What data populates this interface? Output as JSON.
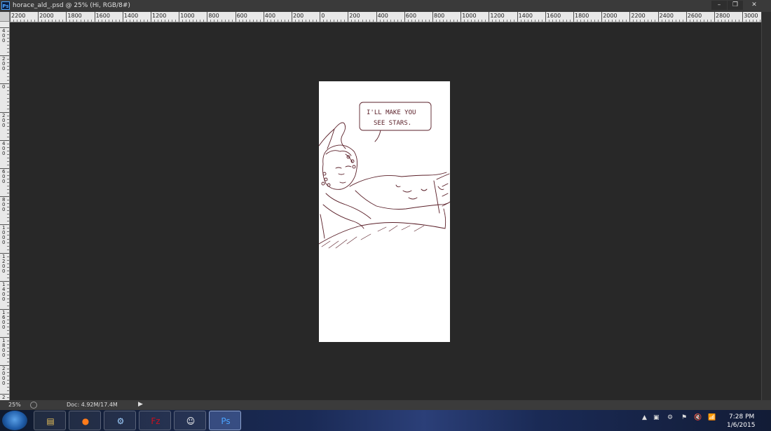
{
  "window": {
    "app_badge": "Ps",
    "title": "horace_ald_.psd @ 25% (Hi, RGB/8#)",
    "controls": {
      "minimize": "–",
      "restore": "❐",
      "close": "✕"
    }
  },
  "ruler_h": {
    "labels": [
      "2200",
      "2000",
      "1800",
      "1600",
      "1400",
      "1200",
      "1000",
      "800",
      "600",
      "400",
      "200",
      "0",
      "200",
      "400",
      "600",
      "800",
      "1000",
      "1200",
      "1400",
      "1600",
      "1800",
      "2000",
      "2200",
      "2400",
      "2600",
      "2800",
      "3000"
    ]
  },
  "ruler_v": {
    "labels": [
      "400",
      "200",
      "0",
      "200",
      "400",
      "600",
      "800",
      "1000",
      "1200",
      "1400",
      "1600",
      "1800",
      "2000",
      "2200"
    ]
  },
  "document": {
    "speech": [
      "I'LL MAKE YOU",
      "SEE STARS."
    ],
    "background_color": "#ffffff",
    "line_color": "#5a1f28"
  },
  "status": {
    "zoom": "25%",
    "doc_info": "Doc: 4.92M/17.4M",
    "arrow": "▶"
  },
  "taskbar": {
    "start": "start-orb",
    "apps": [
      {
        "name": "file-explorer",
        "glyph": "▤",
        "color": "#e8c15a"
      },
      {
        "name": "firefox",
        "glyph": "●",
        "color": "#ff7b1a"
      },
      {
        "name": "network-tool",
        "glyph": "⚙",
        "color": "#9fd0ff"
      },
      {
        "name": "filezilla",
        "glyph": "Fz",
        "color": "#c8101e"
      },
      {
        "name": "pidgin",
        "glyph": "☺",
        "color": "#ffffff"
      },
      {
        "name": "photoshop",
        "glyph": "Ps",
        "color": "#4aa3ff",
        "active": true
      }
    ],
    "tray": {
      "show_hidden": "▲",
      "icons": [
        "▣",
        "⚙",
        "⚑",
        "🔇",
        "📶"
      ]
    },
    "clock": {
      "time": "7:28 PM",
      "date": "1/6/2015"
    }
  },
  "colors": {
    "workspace": "#282828",
    "panel": "#3b3b3b",
    "ruler": "#e8e8e8",
    "accent": "#4aa3ff"
  }
}
